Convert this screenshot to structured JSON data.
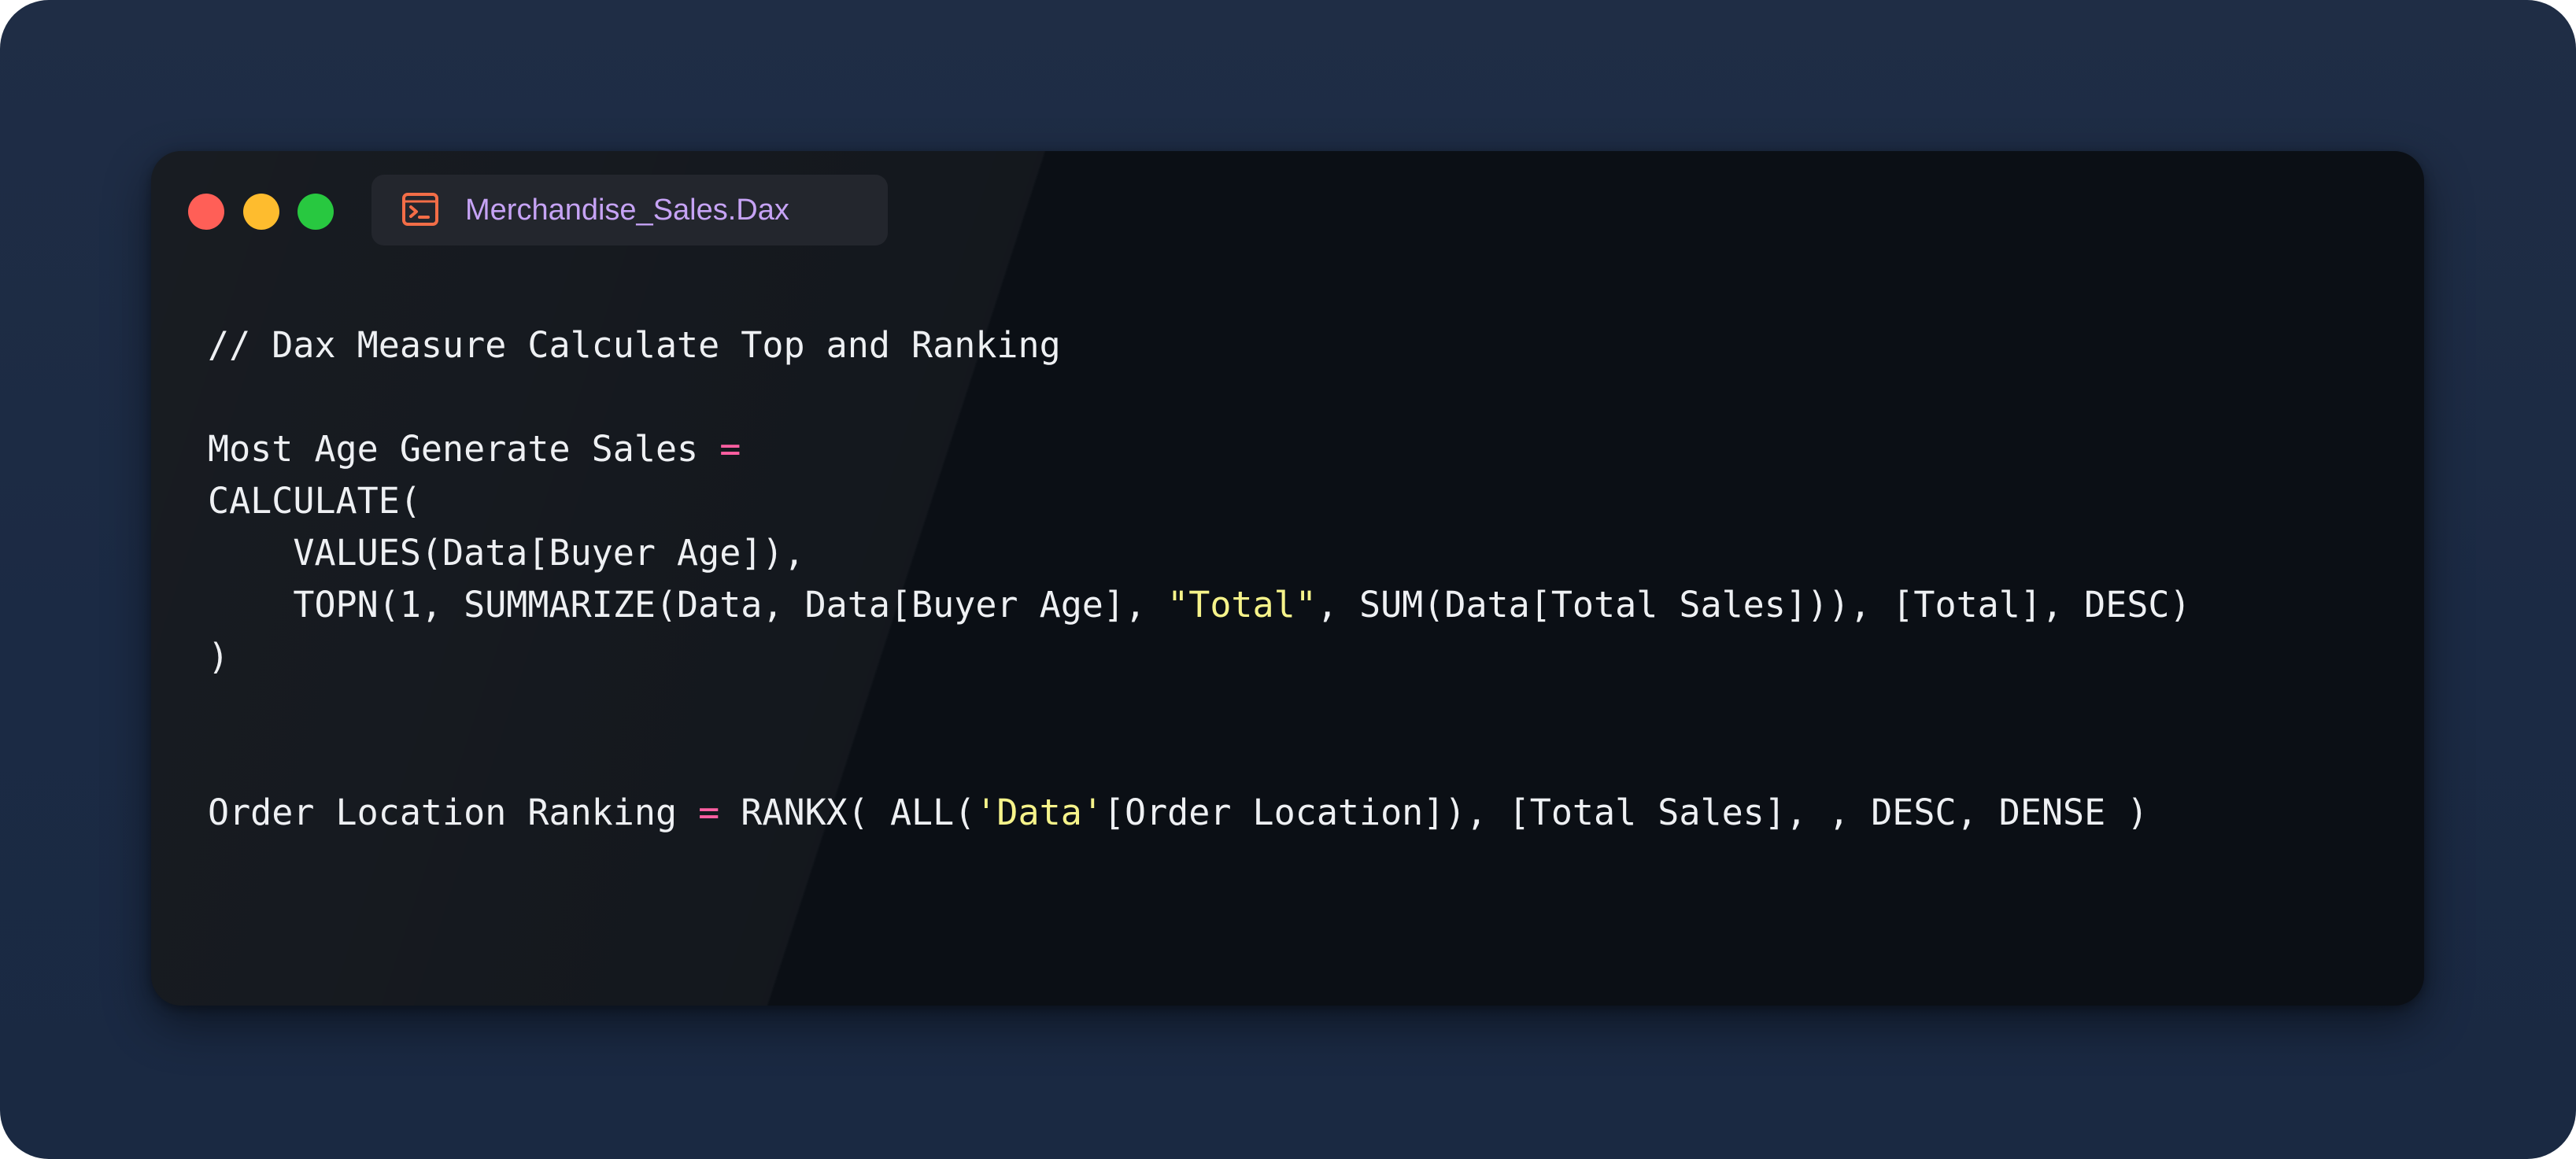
{
  "window": {
    "file_tab": {
      "label": "Merchandise_Sales.Dax",
      "icon": "terminal-icon",
      "icon_color": "#f26d47",
      "label_color": "#c6a3f5"
    },
    "traffic_lights": {
      "close_color": "#ff5f57",
      "minimize_color": "#febc2e",
      "maximize_color": "#28c840"
    }
  },
  "colors": {
    "background": "#1c2b44",
    "window_background": "#0b0f15",
    "code_text": "#eef0f3",
    "operator": "#ff5fa2",
    "string": "#f6f38a"
  },
  "code": {
    "comment": "// Dax Measure Calculate Top and Ranking",
    "measure1_name": "Most Age Generate Sales ",
    "measure1_eq": "=",
    "line_calculate": "CALCULATE(",
    "line_values": "    VALUES(Data[Buyer Age]),",
    "line_topn_pre": "    TOPN(1, SUMMARIZE(Data, Data[Buyer Age], ",
    "line_topn_str": "\"Total\"",
    "line_topn_post": ", SUM(Data[Total Sales])), [Total], DESC)",
    "line_close": ")",
    "measure2_name": "Order Location Ranking ",
    "measure2_eq": "=",
    "measure2_pre": " RANKX( ALL(",
    "measure2_str": "'Data'",
    "measure2_post": "[Order Location]), [Total Sales], , DESC, DENSE )"
  }
}
